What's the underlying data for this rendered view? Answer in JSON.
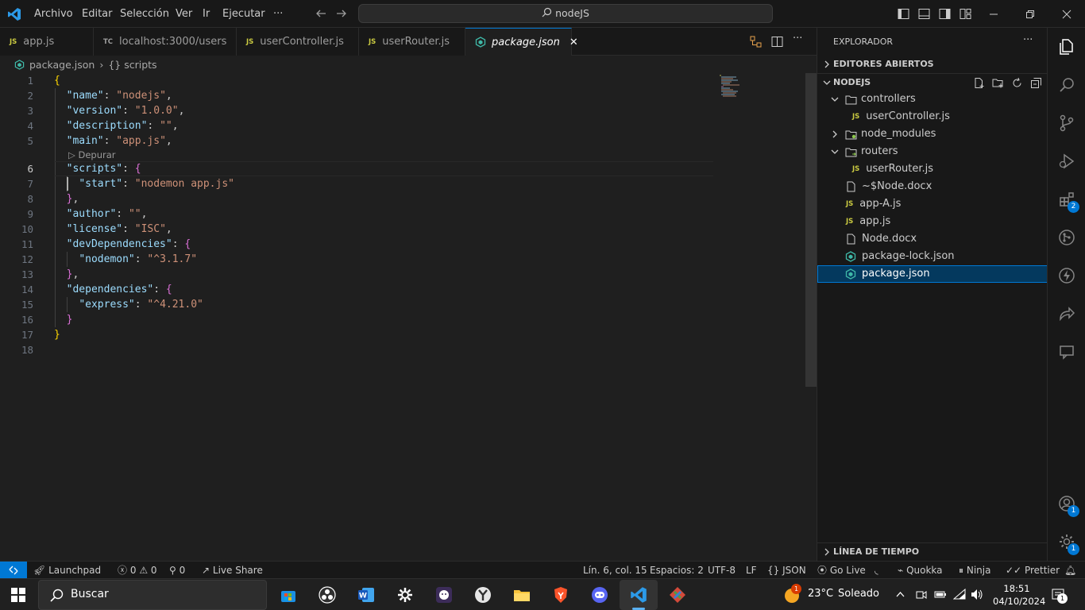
{
  "titlebar": {
    "menu": [
      "Archivo",
      "Editar",
      "Selección",
      "Ver",
      "Ir",
      "Ejecutar"
    ],
    "more": "···",
    "search": "nodeJS"
  },
  "tabs": [
    {
      "badge": "JS",
      "label": "app.js"
    },
    {
      "badge": "TC",
      "label": "localhost:3000/users"
    },
    {
      "badge": "JS",
      "label": "userController.js"
    },
    {
      "badge": "JS",
      "label": "userRouter.js"
    },
    {
      "badge": "json",
      "label": "package.json",
      "close": "✕"
    }
  ],
  "breadcrumb": {
    "file": "package.json",
    "sep": "›",
    "symbol": "{} scripts"
  },
  "editor": {
    "codelens": "Depurar",
    "line_numbers": [
      "1",
      "2",
      "3",
      "4",
      "5",
      "6",
      "7",
      "8",
      "9",
      "10",
      "11",
      "12",
      "13",
      "14",
      "15",
      "16",
      "17",
      "18"
    ],
    "lines": {
      "l1_open": "{",
      "l2_key": "\"name\"",
      "l2_val": "\"nodejs\"",
      "l3_key": "\"version\"",
      "l3_val": "\"1.0.0\"",
      "l4_key": "\"description\"",
      "l4_val": "\"\"",
      "l5_key": "\"main\"",
      "l5_val": "\"app.js\"",
      "l6_key": "\"scripts\"",
      "l6_open": "{",
      "l7_key": "\"start\"",
      "l7_val": "\"nodemon app.js\"",
      "l8_close": "}",
      "l9_key": "\"author\"",
      "l9_val": "\"\"",
      "l10_key": "\"license\"",
      "l10_val": "\"ISC\"",
      "l11_key": "\"devDependencies\"",
      "l11_open": "{",
      "l12_key": "\"nodemon\"",
      "l12_val": "\"^3.1.7\"",
      "l13_close": "}",
      "l14_key": "\"dependencies\"",
      "l14_open": "{",
      "l15_key": "\"express\"",
      "l15_val": "\"^4.21.0\"",
      "l16_close": "}",
      "l17_close": "}",
      "colon": ": ",
      "comma": ","
    }
  },
  "sidebar": {
    "title": "EXPLORADOR",
    "more": "···",
    "open_editors": "EDITORES ABIERTOS",
    "project": "NODEJS",
    "tree": [
      {
        "label": "controllers",
        "type": "folder"
      },
      {
        "label": "userController.js",
        "type": "js"
      },
      {
        "label": "node_modules",
        "type": "folder"
      },
      {
        "label": "routers",
        "type": "folder"
      },
      {
        "label": "userRouter.js",
        "type": "js"
      },
      {
        "label": "~$Node.docx",
        "type": "file"
      },
      {
        "label": "app-A.js",
        "type": "js"
      },
      {
        "label": "app.js",
        "type": "js"
      },
      {
        "label": "Node.docx",
        "type": "file"
      },
      {
        "label": "package-lock.json",
        "type": "json"
      },
      {
        "label": "package.json",
        "type": "json"
      }
    ],
    "timeline": "LÍNEA DE TIEMPO"
  },
  "activity": {
    "ext_badge": "2",
    "account_badge": "1",
    "settings_badge": "1"
  },
  "statusbar": {
    "launchpad": "Launchpad",
    "errors": "0",
    "warnings": "0",
    "ports": "0",
    "liveshare": "Live Share",
    "position": "Lín. 6, col. 15",
    "spaces": "Espacios: 2",
    "encoding": "UTF-8",
    "eol": "LF",
    "lang": "JSON",
    "golive": "Go Live",
    "quokka": "Quokka",
    "ninja": "Ninja",
    "prettier": "Prettier"
  },
  "taskbar": {
    "search": "Buscar",
    "weather_badge": "1",
    "temp": "23°C",
    "weather": "Soleado",
    "time": "18:51",
    "date": "04/10/2024",
    "notif": "1"
  },
  "colors": {
    "accent": "#0078d4",
    "key": "#9cdcfe",
    "string": "#ce9178",
    "bracket1": "#ffd700",
    "bracket2": "#da70d6"
  }
}
